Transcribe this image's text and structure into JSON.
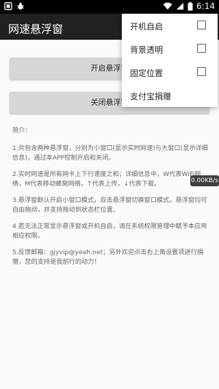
{
  "status_bar": {
    "time": "6:14"
  },
  "app": {
    "title": "网速悬浮窗"
  },
  "buttons": {
    "open_label": "开启悬浮窗",
    "close_label": "关闭悬浮窗"
  },
  "overflow_menu": {
    "items": [
      {
        "label": "开机自启",
        "checked": false
      },
      {
        "label": "背景透明",
        "checked": false
      },
      {
        "label": "固定位置",
        "checked": false
      },
      {
        "label": "支付宝捐赠"
      }
    ]
  },
  "intro": {
    "heading": "简介：",
    "paragraphs": [
      "1.共包含两种悬浮窗，分别为小窗口(显示实时网速)与大窗口(显示详细信息)，通过本APP控制开启和关闭。",
      "2.实时网速是所有网卡上下行速度之和；详细信息中，W代表WiFi网络，M代表移动蜂窝网络，↑代表上传，↓代表下载。",
      "3.悬浮窗默认开启小窗口模式，双击悬浮窗切换窗口模式，悬浮窗均可自由拖动，并支持拖动到状态栏位置。",
      "4.若无法正常显示悬浮窗或开机自启，请在系统权限管理中赋予本应用相应权限。",
      "5.反馈邮箱：gjyvip@yeah.net；另外欢迎点击右上角设置项进行捐赠，您的支持是我前行的动力！"
    ]
  },
  "floating_speed": {
    "value": "0.00KB/s"
  }
}
